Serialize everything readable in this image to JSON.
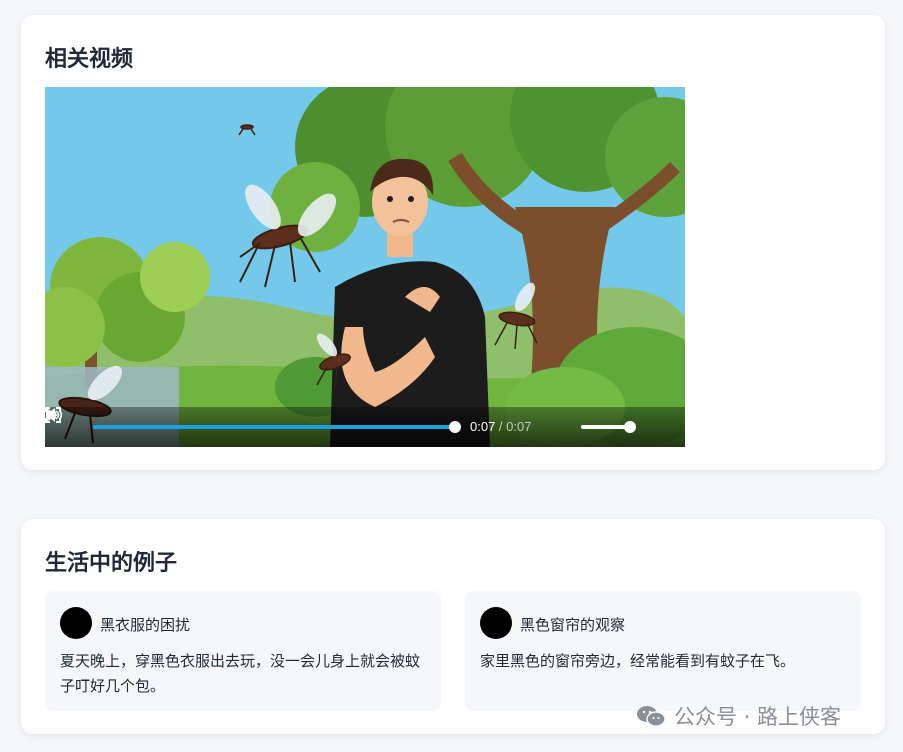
{
  "related_videos": {
    "title": "相关视频",
    "player": {
      "current_time": "0:07",
      "separator": " / ",
      "duration": "0:07",
      "progress": 1.0,
      "volume": 0.95
    }
  },
  "examples": {
    "title": "生活中的例子",
    "items": [
      {
        "title": "黑衣服的困扰",
        "body": "夏天晚上，穿黑色衣服出去玩，没一会儿身上就会被蚊子叮好几个包。"
      },
      {
        "title": "黑色窗帘的观察",
        "body": "家里黑色的窗帘旁边，经常能看到有蚊子在飞。"
      }
    ]
  },
  "watermark": {
    "text": "公众号 · 路上侠客"
  },
  "icons": [
    "play-icon",
    "volume-icon",
    "fullscreen-icon",
    "wechat-icon"
  ],
  "colors": {
    "accent": "#1aa0e3",
    "card_bg": "#ffffff",
    "page_bg": "#f5f7fa",
    "example_bg": "#f5f7fa"
  }
}
